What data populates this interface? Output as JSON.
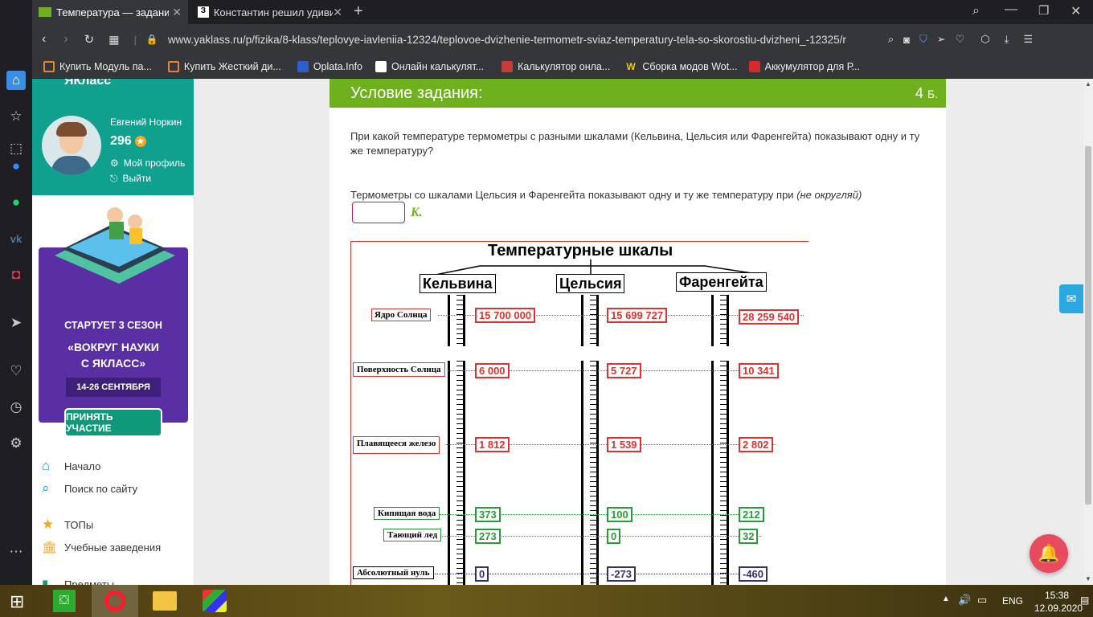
{
  "browser": {
    "tabs": [
      {
        "label": "Температура — задание. ("
      },
      {
        "label": "Константин решил удивит"
      }
    ],
    "new_tab": "+",
    "url": "www.yaklass.ru/p/fizika/8-klass/teplovye-iavleniia-12324/teplovoe-dvizhenie-termometr-sviaz-temperatury-tela-so-skorostiu-dvizheni_-12325/r",
    "bookmarks": [
      {
        "label": "Купить Модуль па...",
        "color": "#e5862d"
      },
      {
        "label": "Купить Жесткий ди...",
        "color": "#e5862d"
      },
      {
        "label": "Oplata.Info",
        "color": "#2d5fd0"
      },
      {
        "label": "Онлайн калькулят...",
        "color": "#ffffff"
      },
      {
        "label": "Калькулятор онла...",
        "color": "#c83b3b"
      },
      {
        "label": "Сборка модов Wot...",
        "color": "#f0c814"
      },
      {
        "label": "Аккумулятор для Р...",
        "color": "#d8282a"
      }
    ]
  },
  "sidebar": {
    "logo": "ЯКласс",
    "user_name": "Евгений Норкин",
    "points": "296",
    "profile_link": "Мой профиль",
    "logout_link": "Выйти",
    "banner": {
      "line1": "СТАРТУЕТ  3 СЕЗОН",
      "line2": "«ВОКРУГ НАУКИ",
      "line3": "С ЯКЛАСС»",
      "dates": "14-26 СЕНТЯБРЯ",
      "button": "ПРИНЯТЬ УЧАСТИЕ"
    },
    "nav": [
      {
        "label": "Начало"
      },
      {
        "label": "Поиск по сайту"
      },
      {
        "label": "ТОПы"
      },
      {
        "label": "Учебные заведения"
      },
      {
        "label": "Предметы"
      }
    ]
  },
  "task": {
    "header": "Условие задания:",
    "score_num": "4",
    "score_unit": "Б.",
    "question": "При какой температуре термометры с разными шкалами (Кельвина, Цельсия или Фаренгейта) показывают одну и ту же температуру?",
    "prompt": "Термометры со шкалами Цельсия и Фаренгейта показывают одну и ту же температуру при ",
    "hint": "(не округляй)",
    "answer_value": "",
    "unit": "K."
  },
  "figure": {
    "title": "Температурные шкалы",
    "scales": [
      "Кельвина",
      "Цельсия",
      "Фаренгейта"
    ],
    "rows": [
      {
        "label": "Ядро Солнца",
        "k": "15 700 000",
        "c": "15 699 727",
        "f": "28 259 540"
      },
      {
        "label": "Поверхность Солнца",
        "k": "6 000",
        "c": "5 727",
        "f": "10 341"
      },
      {
        "label": "Плавящееся железо",
        "k": "1 812",
        "c": "1 539",
        "f": "2 802"
      },
      {
        "label": "Кипящая вода",
        "k": "373",
        "c": "100",
        "f": "212"
      },
      {
        "label": "Тающий лед",
        "k": "273",
        "c": "0",
        "f": "32"
      },
      {
        "label": "Абсолютный нуль",
        "k": "0",
        "c": "-273",
        "f": "-460"
      }
    ]
  },
  "taskbar": {
    "lang": "ENG",
    "time": "15:38",
    "date": "12.09.2020"
  }
}
